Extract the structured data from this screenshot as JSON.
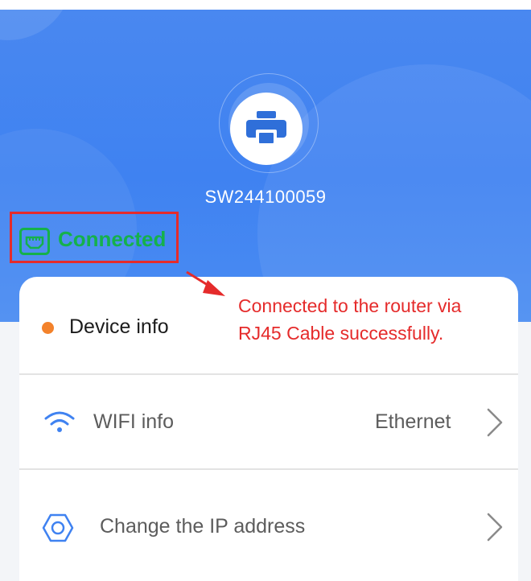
{
  "device": {
    "id": "SW244100059",
    "avatar_icon": "printer-icon"
  },
  "connection": {
    "status": "Connected",
    "icon": "ethernet-port-icon",
    "color": "#15b14b"
  },
  "annotation": {
    "line1": "Connected to the router via",
    "line2": "RJ45 Cable successfully.",
    "color": "#e52b2b"
  },
  "menu": {
    "device_info": {
      "label": "Device info",
      "icon": "status-dot",
      "color": "#f3822b"
    },
    "wifi_info": {
      "label": "WIFI info",
      "value": "Ethernet",
      "icon": "wifi-icon"
    },
    "change_ip": {
      "label": "Change the IP address",
      "icon": "settings-icon"
    }
  },
  "colors": {
    "header": "#4a88f0",
    "accent": "#3f82f1"
  }
}
